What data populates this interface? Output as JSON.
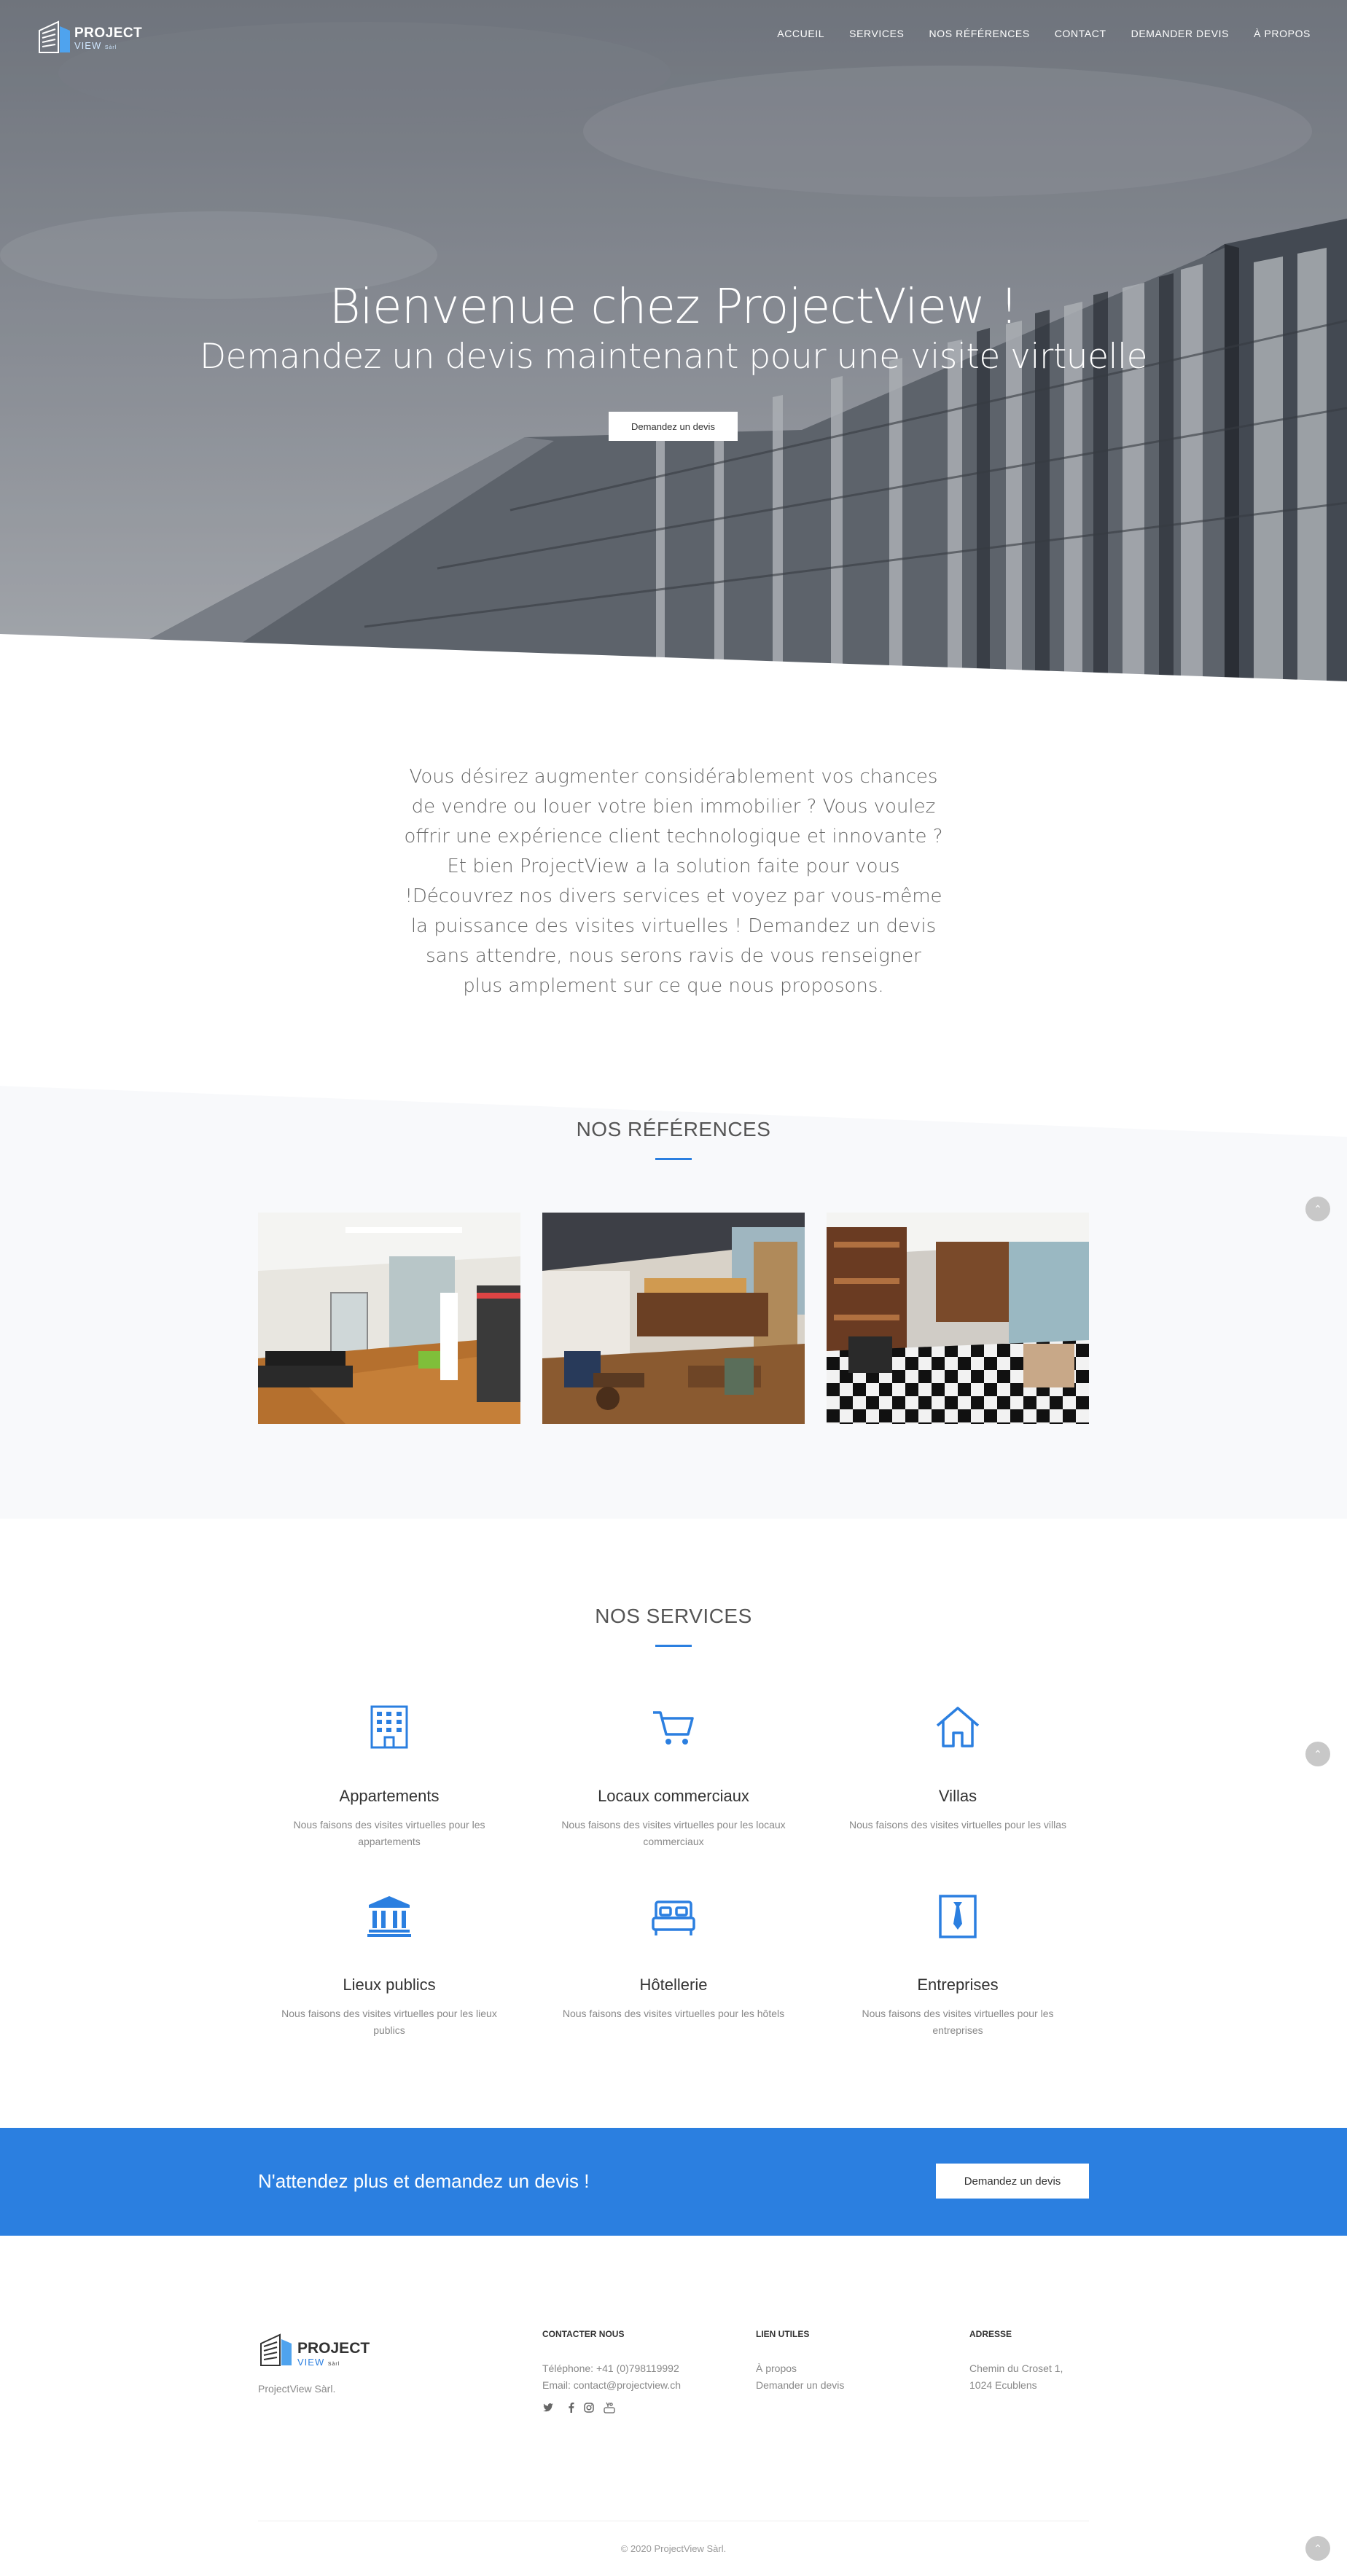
{
  "nav": {
    "logo_line1": "PROJECT",
    "logo_line2": "VIEW",
    "logo_suffix": "Sàrl",
    "items": [
      "ACCUEIL",
      "SERVICES",
      "NOS RÉFÉRENCES",
      "CONTACT",
      "DEMANDER DEVIS",
      "À PROPOS"
    ]
  },
  "hero": {
    "title": "Bienvenue chez ProjectView !",
    "subtitle": "Demandez un devis maintenant pour une visite virtuelle",
    "button": "Demandez un devis"
  },
  "intro": {
    "text": "Vous désirez augmenter considérablement vos chances de vendre ou louer votre bien immobilier ? Vous voulez offrir une expérience client technologique et innovante ? Et bien ProjectView a la solution faite pour vous !Découvrez nos divers services et voyez par vous-même la puissance des visites virtuelles ! Demandez un devis sans attendre, nous serons ravis de vous renseigner plus amplement sur ce que nous proposons."
  },
  "references": {
    "title": "NOS RÉFÉRENCES",
    "images": [
      "office-interior-photo",
      "restaurant-bar-photo",
      "hair-salon-photo"
    ]
  },
  "services": {
    "title": "NOS SERVICES",
    "items": [
      {
        "icon": "building-icon",
        "title": "Appartements",
        "desc": "Nous faisons des visites virtuelles pour les appartements"
      },
      {
        "icon": "cart-icon",
        "title": "Locaux commerciaux",
        "desc": "Nous faisons des visites virtuelles pour les locaux commerciaux"
      },
      {
        "icon": "house-icon",
        "title": "Villas",
        "desc": "Nous faisons des visites virtuelles pour les villas"
      },
      {
        "icon": "institution-icon",
        "title": "Lieux publics",
        "desc": "Nous faisons des visites virtuelles pour les lieux publics"
      },
      {
        "icon": "bed-icon",
        "title": "Hôtellerie",
        "desc": "Nous faisons des visites virtuelles pour les hôtels"
      },
      {
        "icon": "tie-icon",
        "title": "Entreprises",
        "desc": "Nous faisons des visites virtuelles pour les entreprises"
      }
    ]
  },
  "cta": {
    "text": "N'attendez plus et demandez un devis !",
    "button": "Demandez un devis"
  },
  "footer": {
    "logo_line1": "PROJECT",
    "logo_line2": "VIEW",
    "logo_suffix": "Sàrl",
    "company": "ProjectView Sàrl.",
    "contact_heading": "CONTACTER NOUS",
    "phone": "Téléphone: +41 (0)798119992",
    "email": "Email: contact@projectview.ch",
    "links_heading": "LIEN UTILES",
    "link_about": "À propos",
    "link_quote": "Demander un devis",
    "address_heading": "ADRESSE",
    "address_line1": "Chemin du Croset 1,",
    "address_line2": "1024 Ecublens",
    "social": [
      "twitter-icon",
      "facebook-icon",
      "instagram-icon",
      "youtube-icon"
    ],
    "copyright": "© 2020 ProjectView Sàrl."
  },
  "colors": {
    "accent": "#2b7fe0",
    "light_bg": "#f8f9fb"
  }
}
